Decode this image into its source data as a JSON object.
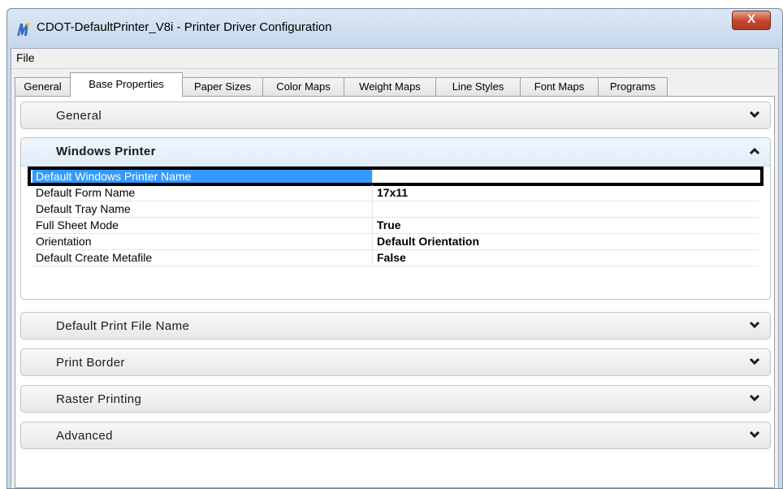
{
  "window": {
    "title": "CDOT-DefaultPrinter_V8i - Printer Driver Configuration",
    "close_label": "X"
  },
  "menu": {
    "file_label": "File"
  },
  "tabs": [
    {
      "label": "General"
    },
    {
      "label": "Base Properties"
    },
    {
      "label": "Paper Sizes"
    },
    {
      "label": "Color Maps"
    },
    {
      "label": "Weight Maps"
    },
    {
      "label": "Line Styles"
    },
    {
      "label": "Font Maps"
    },
    {
      "label": "Programs"
    }
  ],
  "active_tab": "Base Properties",
  "sections": {
    "general": {
      "label": "General",
      "icon": "chevron-down-icon"
    },
    "windows_printer": {
      "label": "Windows Printer",
      "icon": "chevron-up-icon",
      "properties": [
        {
          "name": "Default Windows Printer Name",
          "value": ""
        },
        {
          "name": "Default Form Name",
          "value": "17x11"
        },
        {
          "name": "Default Tray Name",
          "value": ""
        },
        {
          "name": "Full Sheet Mode",
          "value": "True"
        },
        {
          "name": "Orientation",
          "value": "Default Orientation"
        },
        {
          "name": "Default Create Metafile",
          "value": "False"
        }
      ],
      "selected_row": 0
    },
    "default_print_file_name": {
      "label": "Default Print File Name",
      "icon": "chevron-down-icon"
    },
    "print_border": {
      "label": "Print Border",
      "icon": "chevron-down-icon"
    },
    "raster_printing": {
      "label": "Raster Printing",
      "icon": "chevron-down-icon"
    },
    "advanced": {
      "label": "Advanced",
      "icon": "chevron-down-icon"
    }
  },
  "colors": {
    "selection": "#3399ff",
    "close_button": "#c7442c",
    "highlight_border": "#000000"
  }
}
